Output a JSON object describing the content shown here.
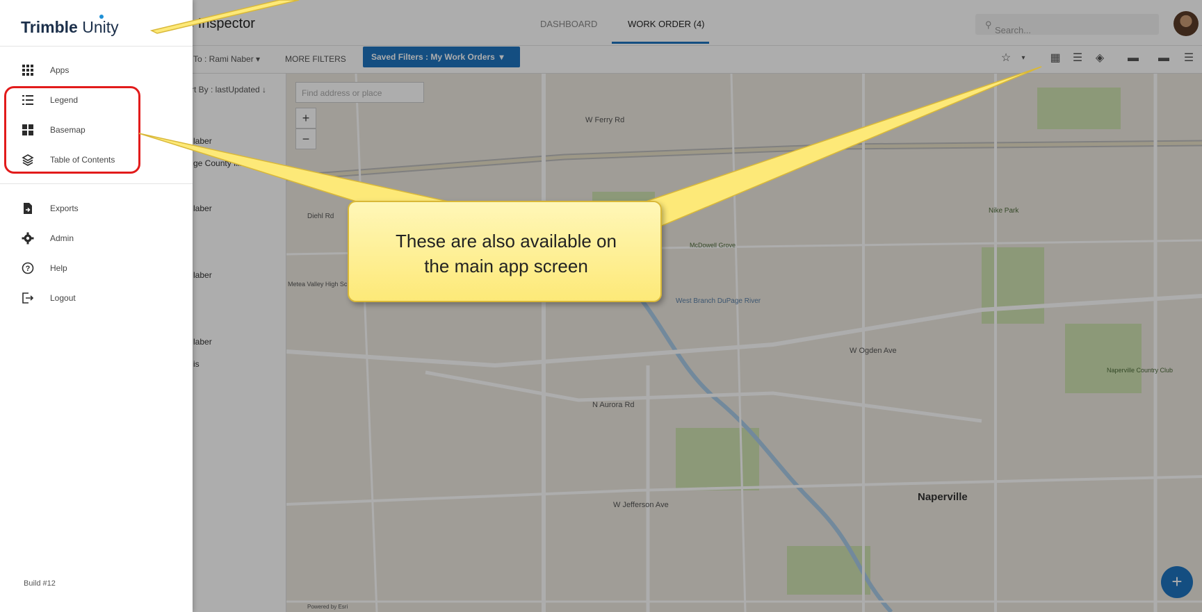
{
  "header": {
    "app_title": "ve Inspector",
    "tabs": [
      {
        "label": "DASHBOARD"
      },
      {
        "label": "WORK ORDER (4)"
      }
    ],
    "search_placeholder": "Search..."
  },
  "filterbar": {
    "assigned_to": "To : Rami Naber",
    "more_filters": "MORE FILTERS",
    "saved_filters": "Saved Filters : My Work Orders"
  },
  "list": {
    "sort_label": "rt By : lastUpdated",
    "items": [
      {
        "line1": "laber",
        "line2": "ge County Illinois"
      },
      {
        "line1": "laber",
        "line2": ""
      },
      {
        "line1": "laber",
        "line2": ""
      },
      {
        "line1": "laber",
        "line2": "is"
      }
    ]
  },
  "map": {
    "search_placeholder": "Find address or place",
    "zoom_in": "+",
    "zoom_out": "−",
    "fab_label": "+",
    "labels": {
      "city": "Naperville",
      "road_ogden": "W Ogden Ave",
      "road_aurora": "N Aurora Rd",
      "road_jefferson": "W Jefferson Ave",
      "road_ferry": "W Ferry Rd",
      "road_diehl": "Diehl Rd",
      "school": "Metea Valley High School",
      "park": "Nike Park",
      "club": "Naperville Country Club",
      "mcdowell": "McDowell Grove",
      "river": "West Branch DuPage River",
      "credit": "Powered by Esri"
    }
  },
  "drawer": {
    "brand_bold": "Trimble",
    "brand_light": "Unity",
    "menu_group1": [
      {
        "label": "Apps",
        "icon": "apps-grid-icon"
      },
      {
        "label": "Legend",
        "icon": "legend-list-icon"
      },
      {
        "label": "Basemap",
        "icon": "basemap-icon"
      },
      {
        "label": "Table of Contents",
        "icon": "layers-icon"
      }
    ],
    "menu_group2": [
      {
        "label": "Exports",
        "icon": "file-export-icon"
      },
      {
        "label": "Admin",
        "icon": "gear-icon"
      },
      {
        "label": "Help",
        "icon": "help-circle-icon"
      },
      {
        "label": "Logout",
        "icon": "logout-icon"
      }
    ],
    "build": "Build #12"
  },
  "callout": {
    "line1": "These are also available on",
    "line2": "the main app screen",
    "fill_color": "#fde978",
    "highlight_color": "#e21b1b"
  }
}
